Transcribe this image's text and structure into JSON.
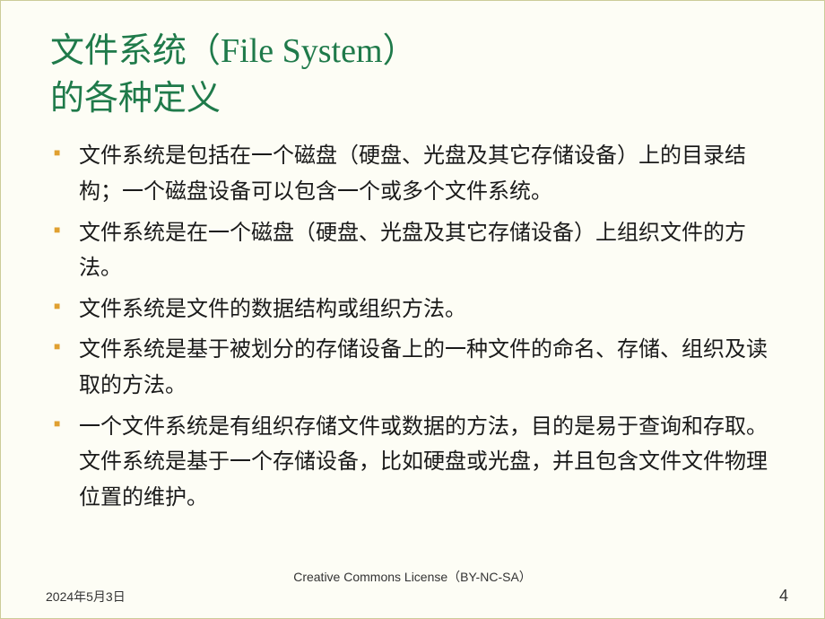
{
  "title": {
    "line1": "文件系统（File System）",
    "line2": "的各种定义"
  },
  "bullets": [
    "文件系统是包括在一个磁盘（硬盘、光盘及其它存储设备）上的目录结构；一个磁盘设备可以包含一个或多个文件系统。",
    "文件系统是在一个磁盘（硬盘、光盘及其它存储设备）上组织文件的方法。",
    "文件系统是文件的数据结构或组织方法。",
    "文件系统是基于被划分的存储设备上的一种文件的命名、存储、组织及读取的方法。",
    "一个文件系统是有组织存储文件或数据的方法，目的是易于查询和存取。文件系统是基于一个存储设备，比如硬盘或光盘，并且包含文件文件物理位置的维护。"
  ],
  "footer": {
    "date": "2024年5月3日",
    "license": "Creative Commons License（BY-NC-SA）",
    "page": "4"
  }
}
